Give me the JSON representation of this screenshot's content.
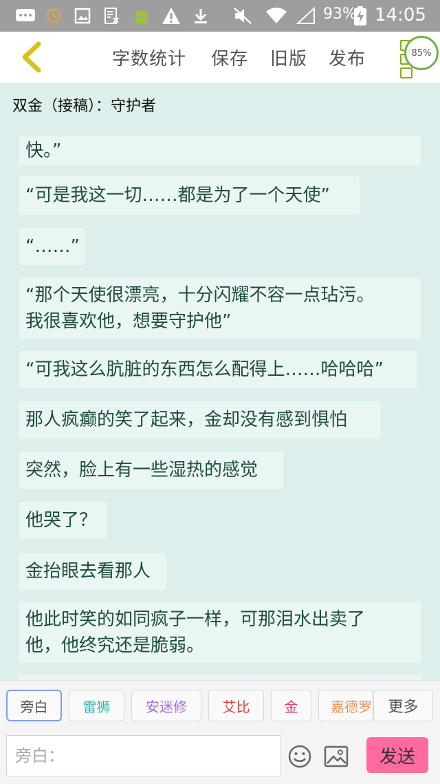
{
  "status_bar": {
    "battery_text": "93%",
    "time": "14:05",
    "icons": [
      "message-icon",
      "sync-icon",
      "image-icon",
      "sim-icon",
      "android-icon",
      "warning-icon",
      "download-icon",
      "mute-icon",
      "wifi-icon",
      "signal-icon",
      "battery-icon"
    ]
  },
  "toolbar": {
    "back_icon": "back-arrow-icon",
    "word_count_label": "字数统计",
    "save_label": "保存",
    "old_version_label": "旧版",
    "publish_label": "发布",
    "menu_icon": "menu-icon",
    "progress_label": "85%"
  },
  "chat_title": "双金（接稿）：守护者",
  "messages": [
    {
      "text": "快。”"
    },
    {
      "text": "“可是我这一切……都是为了一个天使”"
    },
    {
      "text": "“……”"
    },
    {
      "text": "“那个天使很漂亮，十分闪耀不容一点玷污。\n我很喜欢他，想要守护他”"
    },
    {
      "text": "“可我这么肮脏的东西怎么配得上……哈哈哈”"
    },
    {
      "text": "那人疯癫的笑了起来，金却没有感到惧怕"
    },
    {
      "text": "突然，脸上有一些湿热的感觉"
    },
    {
      "text": "他哭了？"
    },
    {
      "text": "金抬眼去看那人"
    },
    {
      "text": "他此时笑的如同疯子一样，可那泪水出卖了\n他，他终究还是脆弱。"
    }
  ],
  "roles": [
    {
      "label": "旁白",
      "color": "#555555",
      "selected": true
    },
    {
      "label": "雷狮",
      "color": "#2bb5b0"
    },
    {
      "label": "安迷修",
      "color": "#a66fd6"
    },
    {
      "label": "艾比",
      "color": "#e03e3e"
    },
    {
      "label": "金",
      "color": "#e0306e"
    },
    {
      "label": "嘉德罗斯",
      "color": "#e8955c"
    }
  ],
  "more_label": "更多",
  "input": {
    "placeholder": "旁白：",
    "value": ""
  },
  "emoji_icon": "emoji-icon",
  "picture_icon": "picture-icon",
  "send_label": "发送",
  "colors": {
    "accent": "#ff6b9e",
    "back_arrow": "#d9c21b",
    "bubble": "#eaf6f3",
    "chat_bg": "#dcefec",
    "message_text": "#1e4f38"
  }
}
